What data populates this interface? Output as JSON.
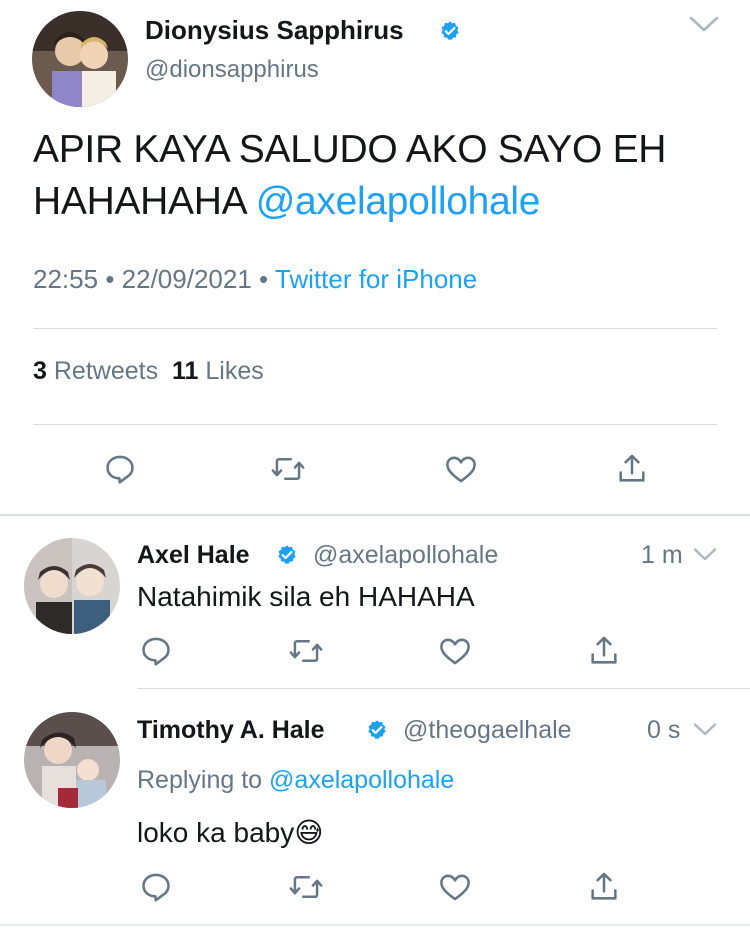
{
  "main_tweet": {
    "author_name": "Dionysius Sapphirus",
    "author_handle": "@dionsapphirus",
    "text_line1": "APIR KAYA SALUDO AKO SAYO EH",
    "text_line2_prefix": "HAHAHAHA ",
    "mention": "@axelapollohale",
    "time": "22:55",
    "separator": "•",
    "date": "22/09/2021",
    "source": "Twitter for iPhone",
    "retweets_count": "3",
    "retweets_label": "Retweets",
    "likes_count": "11",
    "likes_label": "Likes"
  },
  "replies": [
    {
      "author_name": "Axel Hale",
      "author_handle": "@axelapollohale",
      "time": "1 m",
      "text": "Natahimik sila eh HAHAHA"
    },
    {
      "author_name": "Timothy A. Hale",
      "author_handle": "@theogaelhale",
      "time": "0 s",
      "replying_to_label": "Replying to",
      "replying_to_handle": "@axelapollohale",
      "text": "loko ka baby",
      "emoji": "😅"
    }
  ],
  "colors": {
    "accent": "#1da1f2",
    "secondary_text": "#657786",
    "icon": "#657786"
  },
  "icons": {
    "reply": "reply-icon",
    "retweet": "retweet-icon",
    "like": "heart-icon",
    "share": "share-icon",
    "verified": "verified-badge-icon",
    "more": "chevron-down-icon"
  }
}
